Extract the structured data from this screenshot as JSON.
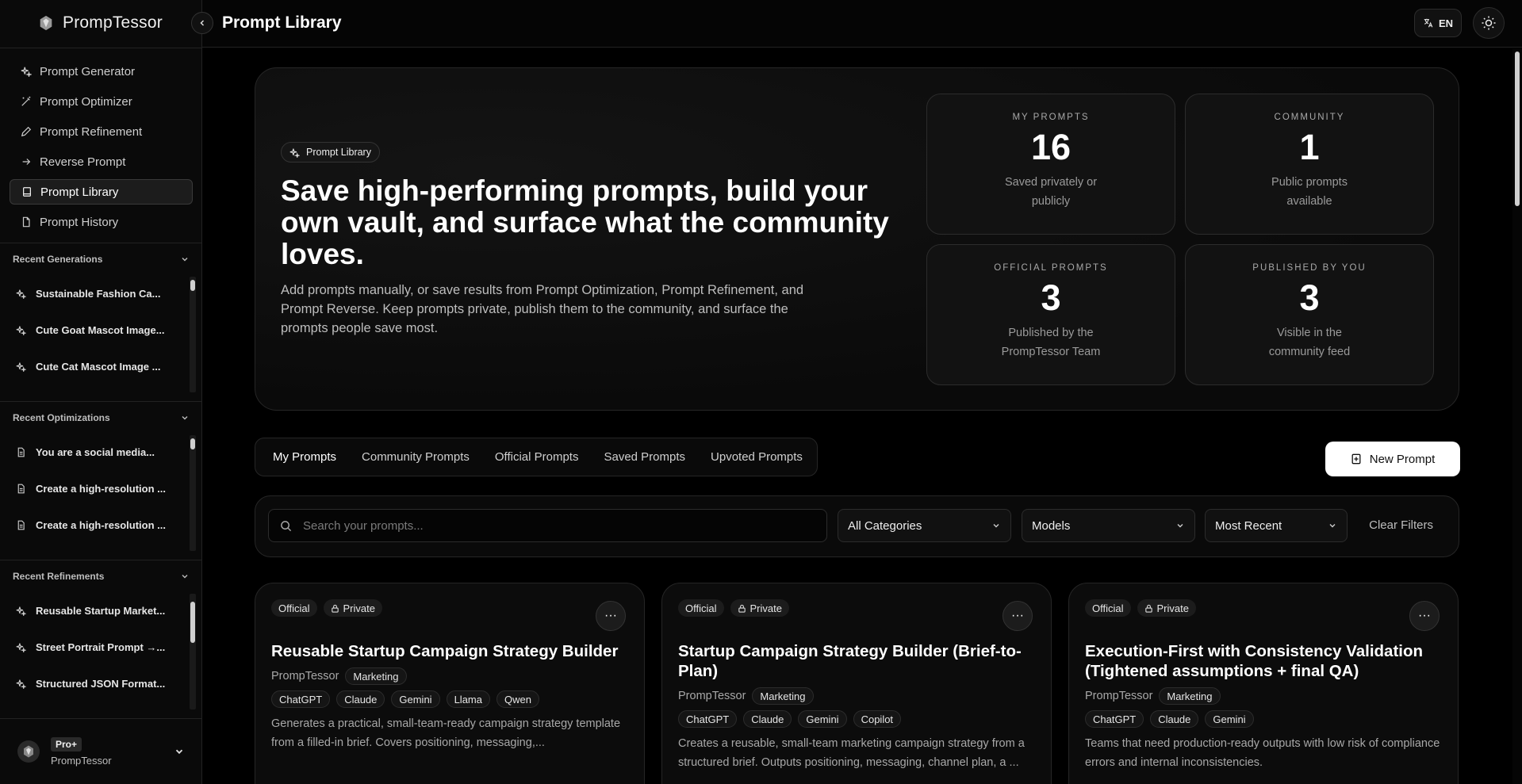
{
  "brand": {
    "name": "PrompTessor"
  },
  "topbar": {
    "title": "Prompt Library",
    "lang": "EN"
  },
  "nav": [
    {
      "label": "Prompt Generator",
      "icon": "sparkles-icon"
    },
    {
      "label": "Prompt Optimizer",
      "icon": "wand-icon"
    },
    {
      "label": "Prompt Refinement",
      "icon": "pencil-icon"
    },
    {
      "label": "Reverse Prompt",
      "icon": "arrow-right-icon"
    },
    {
      "label": "Prompt Library",
      "icon": "book-icon",
      "active": true
    },
    {
      "label": "Prompt History",
      "icon": "file-icon"
    }
  ],
  "sections": [
    {
      "title": "Recent Generations",
      "items": [
        "Sustainable Fashion Ca...",
        "Cute Goat Mascot Image...",
        "Cute Cat Mascot Image ..."
      ]
    },
    {
      "title": "Recent Optimizations",
      "items": [
        "You are a social media...",
        "Create a high-resolution ...",
        "Create a high-resolution ..."
      ]
    },
    {
      "title": "Recent Refinements",
      "items": [
        "Reusable Startup Market...",
        "Street Portrait Prompt →...",
        "Structured JSON Format..."
      ]
    }
  ],
  "user": {
    "plan": "Pro+",
    "name": "PrompTessor"
  },
  "hero": {
    "pill": "Prompt Library",
    "title": "Save high-performing prompts, build your own vault, and surface what the community loves.",
    "description": "Add prompts manually, or save results from Prompt Optimization, Prompt Refinement, and Prompt Reverse. Keep prompts private, publish them to the community, and surface the prompts people save most."
  },
  "stats": [
    {
      "label": "MY PROMPTS",
      "value": "16",
      "desc": "Saved privately or publicly"
    },
    {
      "label": "COMMUNITY",
      "value": "1",
      "desc": "Public prompts available"
    },
    {
      "label": "OFFICIAL PROMPTS",
      "value": "3",
      "desc": "Published by the PrompTessor Team"
    },
    {
      "label": "PUBLISHED BY YOU",
      "value": "3",
      "desc": "Visible in the community feed"
    }
  ],
  "tabs": [
    "My Prompts",
    "Community Prompts",
    "Official Prompts",
    "Saved Prompts",
    "Upvoted Prompts"
  ],
  "new_prompt_label": "New Prompt",
  "filters": {
    "search_placeholder": "Search your prompts...",
    "category": "All Categories",
    "models": "Models",
    "sort": "Most Recent",
    "clear": "Clear Filters"
  },
  "cards": [
    {
      "badges": [
        "Official",
        "Private"
      ],
      "title": "Reusable Startup Campaign Strategy Builder",
      "author": "PrompTessor",
      "category": "Marketing",
      "models": [
        "ChatGPT",
        "Claude",
        "Gemini",
        "Llama",
        "Qwen"
      ],
      "description": "Generates a practical, small-team-ready campaign strategy template from a filled-in brief. Covers positioning, messaging,..."
    },
    {
      "badges": [
        "Official",
        "Private"
      ],
      "title": "Startup Campaign Strategy Builder (Brief-to-Plan)",
      "author": "PrompTessor",
      "category": "Marketing",
      "models": [
        "ChatGPT",
        "Claude",
        "Gemini",
        "Copilot"
      ],
      "description": "Creates a reusable, small-team marketing campaign strategy from a structured brief. Outputs positioning, messaging, channel plan, a ..."
    },
    {
      "badges": [
        "Official",
        "Private"
      ],
      "title": "Execution-First with Consistency Validation (Tightened assumptions + final QA)",
      "author": "PrompTessor",
      "category": "Marketing",
      "models": [
        "ChatGPT",
        "Claude",
        "Gemini"
      ],
      "description": "Teams that need production-ready outputs with low risk of compliance errors and internal inconsistencies."
    }
  ]
}
